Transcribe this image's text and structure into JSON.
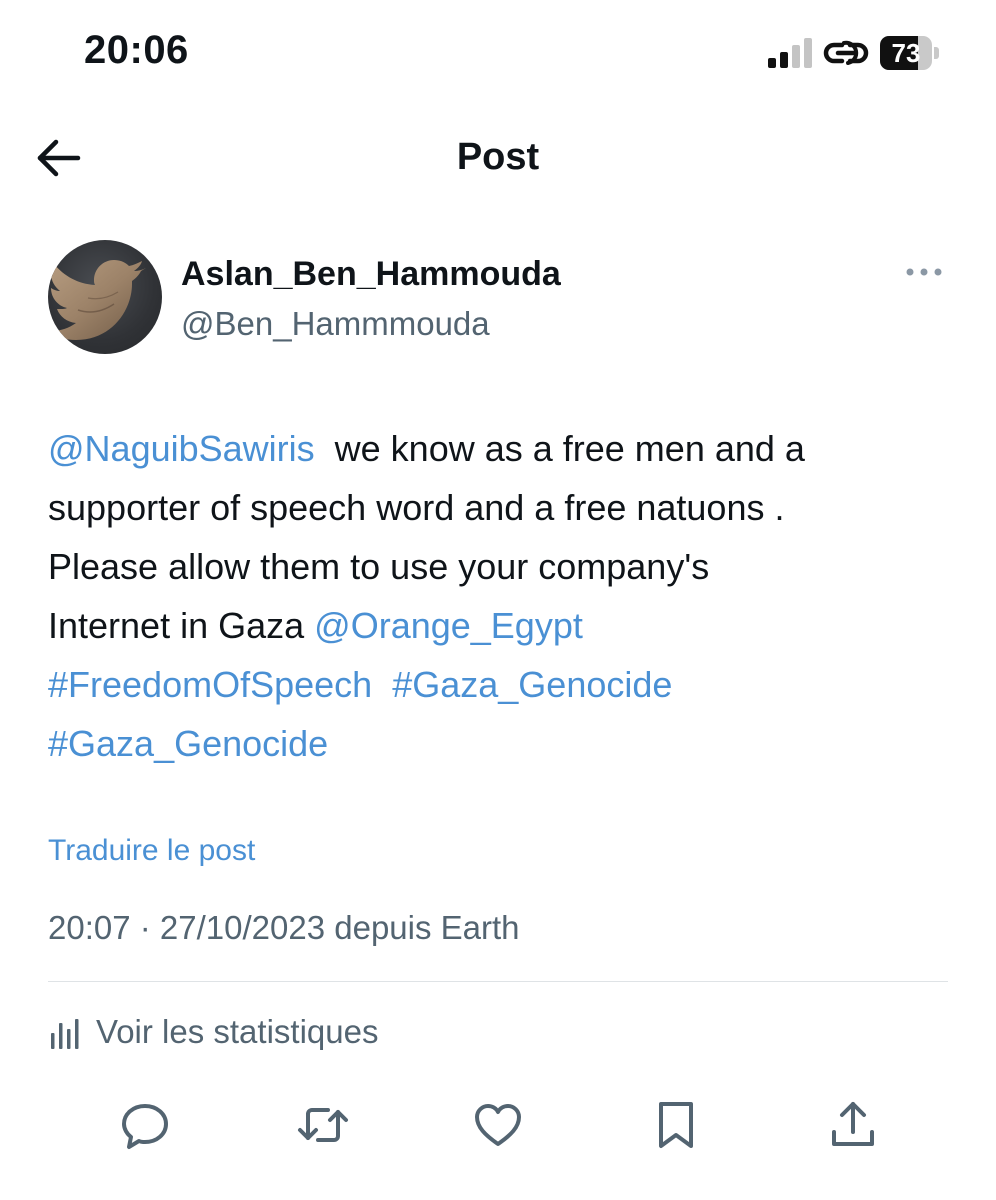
{
  "status_bar": {
    "time": "20:06",
    "battery_percent": 73,
    "battery_label": "73",
    "icons": [
      "cellular-signal-icon",
      "link-icon",
      "battery-icon"
    ]
  },
  "header": {
    "title": "Post",
    "back_icon": "arrow-left-icon"
  },
  "author": {
    "display_name": "Aslan_Ben_Hammouda",
    "handle": "@Ben_Hammmouda",
    "more_icon": "more-horizontal-icon"
  },
  "tweet": {
    "lines": [
      [
        {
          "text": "@NaguibSawiris",
          "link": true
        },
        {
          "text": "  we know as a free men and a",
          "link": false
        }
      ],
      [
        {
          "text": "supporter of speech word and a free natuons .",
          "link": false
        }
      ],
      [
        {
          "text": "Please allow them to use your company's",
          "link": false
        }
      ],
      [
        {
          "text": "Internet in Gaza ",
          "link": false
        },
        {
          "text": "@Orange_Egypt",
          "link": true
        }
      ],
      [
        {
          "text": "#FreedomOfSpeech",
          "link": true
        },
        {
          "text": "  ",
          "link": false
        },
        {
          "text": "#Gaza_Genocide",
          "link": true
        }
      ],
      [
        {
          "text": "#Gaza_Genocide",
          "link": true
        }
      ]
    ],
    "translate_label": "Traduire le post",
    "timestamp": "20:07 · 27/10/2023 depuis Earth",
    "stats_label": "Voir les statistiques"
  },
  "actions": [
    {
      "name": "reply",
      "icon": "reply-bubble-icon"
    },
    {
      "name": "repost",
      "icon": "repost-icon"
    },
    {
      "name": "like",
      "icon": "heart-icon"
    },
    {
      "name": "bookmark",
      "icon": "bookmark-icon"
    },
    {
      "name": "share",
      "icon": "share-icon"
    }
  ],
  "colors": {
    "text": "#0f1419",
    "secondary": "#536471",
    "link": "#4a90d4",
    "divider": "#dfe3e6"
  }
}
